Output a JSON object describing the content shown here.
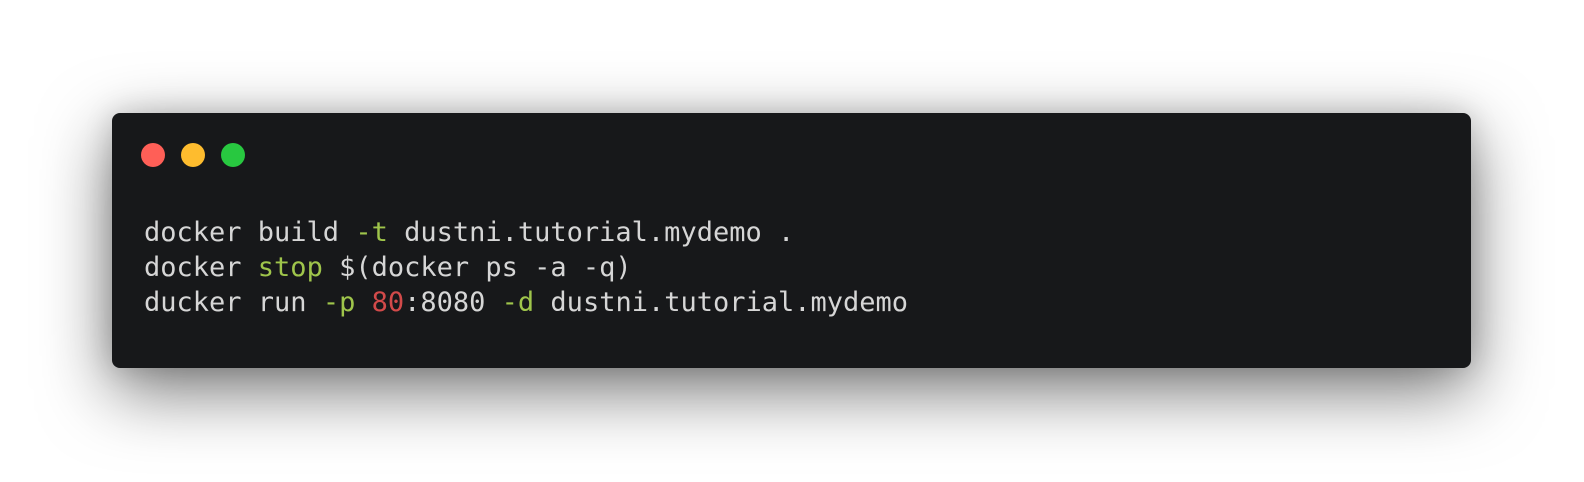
{
  "window": {
    "controls": [
      {
        "name": "close",
        "color": "#ff5f57"
      },
      {
        "name": "minimize",
        "color": "#febc2e"
      },
      {
        "name": "maximize",
        "color": "#28c840"
      }
    ]
  },
  "code": {
    "lines": [
      [
        {
          "text": "docker build ",
          "type": "plain"
        },
        {
          "text": "-t",
          "type": "flag"
        },
        {
          "text": " dustni.tutorial.mydemo .",
          "type": "plain"
        }
      ],
      [
        {
          "text": "docker ",
          "type": "plain"
        },
        {
          "text": "stop",
          "type": "keyword"
        },
        {
          "text": " $(docker ps -a -q)",
          "type": "plain"
        }
      ],
      [
        {
          "text": "ducker run ",
          "type": "plain"
        },
        {
          "text": "-p",
          "type": "flag"
        },
        {
          "text": " ",
          "type": "plain"
        },
        {
          "text": "80",
          "type": "number"
        },
        {
          "text": ":8080 ",
          "type": "plain"
        },
        {
          "text": "-d",
          "type": "flag"
        },
        {
          "text": " dustni.tutorial.mydemo",
          "type": "plain"
        }
      ]
    ]
  }
}
